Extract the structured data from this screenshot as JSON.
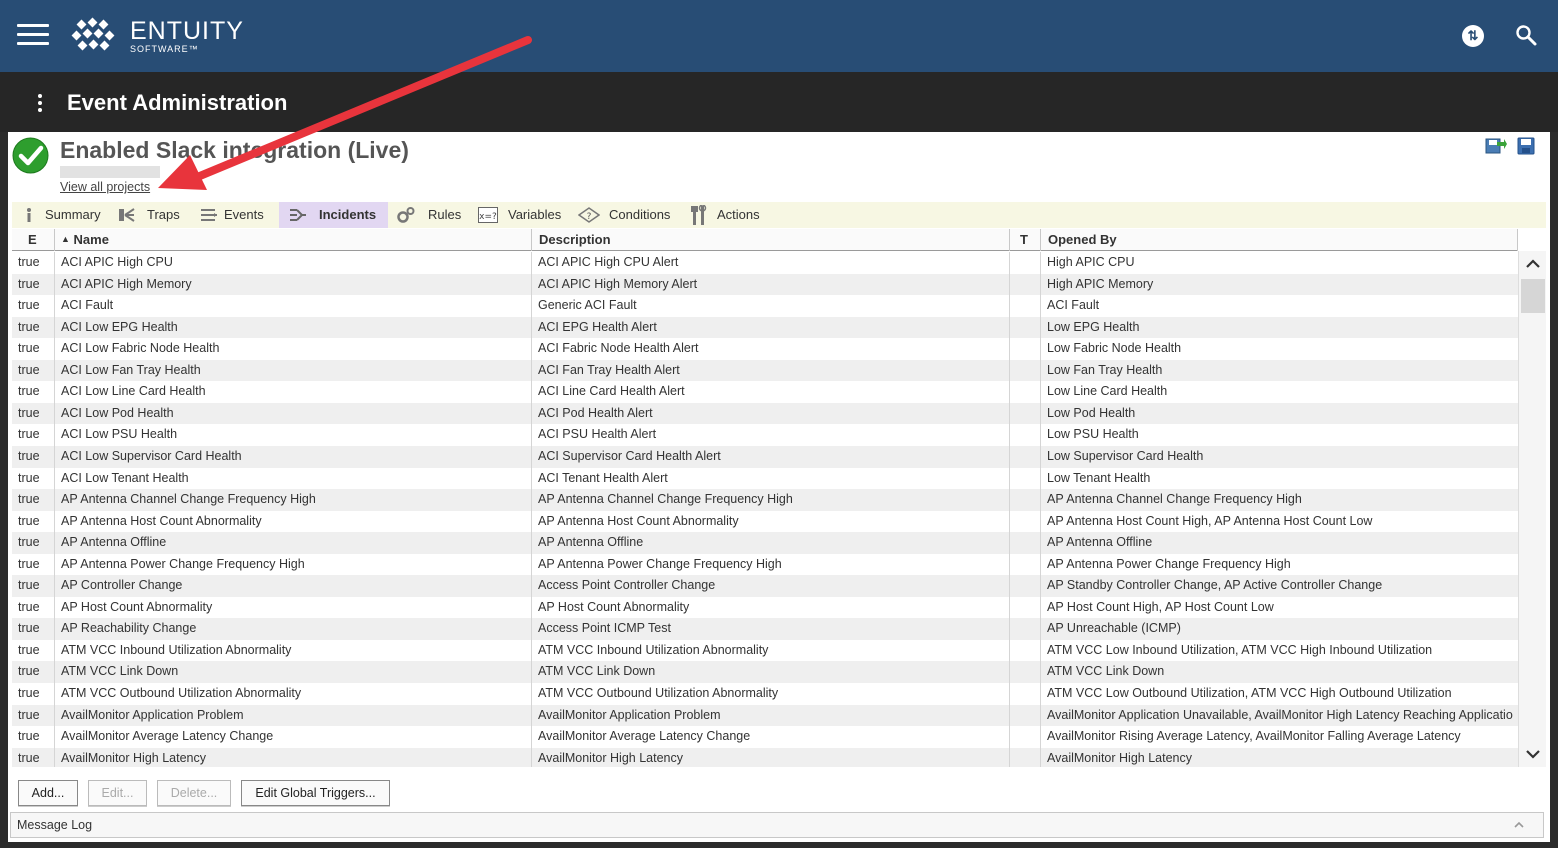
{
  "header": {
    "logo_name": "ENTUITY",
    "logo_sub": "SOFTWARE™",
    "brand_color": "#284d75",
    "icons": {
      "menu": "hamburger-icon",
      "sync": "sync-icon",
      "search": "search-icon"
    }
  },
  "page": {
    "title": "Event Administration",
    "menu_icon": "kebab-menu-icon"
  },
  "project": {
    "title": "Enabled Slack integration (Live)",
    "status_icon": "check-circle-icon",
    "status_color": "#2e9e2e",
    "view_all_link": "View all projects",
    "toolbar_icons": [
      "export-icon",
      "save-icon"
    ]
  },
  "tabs": [
    {
      "label": "Summary",
      "icon": "info-icon"
    },
    {
      "label": "Traps",
      "icon": "traps-icon"
    },
    {
      "label": "Events",
      "icon": "events-icon"
    },
    {
      "label": "Incidents",
      "icon": "incidents-icon",
      "active": true
    },
    {
      "label": "Rules",
      "icon": "gears-icon"
    },
    {
      "label": "Variables",
      "icon": "variables-icon"
    },
    {
      "label": "Conditions",
      "icon": "conditions-icon"
    },
    {
      "label": "Actions",
      "icon": "tools-icon"
    }
  ],
  "table": {
    "columns": [
      {
        "label": "E"
      },
      {
        "label": "Name",
        "sort": "ascending"
      },
      {
        "label": "Description"
      },
      {
        "label": "T"
      },
      {
        "label": "Opened By"
      }
    ],
    "rows": [
      [
        "true",
        "ACI APIC High CPU",
        "ACI APIC High CPU Alert",
        "",
        "High APIC CPU"
      ],
      [
        "true",
        "ACI APIC High Memory",
        "ACI APIC High Memory Alert",
        "",
        "High APIC Memory"
      ],
      [
        "true",
        "ACI Fault",
        "Generic ACI Fault",
        "",
        "ACI Fault"
      ],
      [
        "true",
        "ACI Low EPG Health",
        "ACI EPG Health Alert",
        "",
        "Low EPG Health"
      ],
      [
        "true",
        "ACI Low Fabric Node Health",
        "ACI Fabric Node Health Alert",
        "",
        "Low Fabric Node Health"
      ],
      [
        "true",
        "ACI Low Fan Tray Health",
        "ACI Fan Tray Health Alert",
        "",
        "Low Fan Tray Health"
      ],
      [
        "true",
        "ACI Low Line Card Health",
        "ACI Line Card Health Alert",
        "",
        "Low Line Card Health"
      ],
      [
        "true",
        "ACI Low Pod Health",
        "ACI Pod Health Alert",
        "",
        "Low Pod Health"
      ],
      [
        "true",
        "ACI Low PSU Health",
        "ACI PSU Health Alert",
        "",
        "Low PSU Health"
      ],
      [
        "true",
        "ACI Low Supervisor Card Health",
        "ACI Supervisor Card Health Alert",
        "",
        "Low Supervisor Card Health"
      ],
      [
        "true",
        "ACI Low Tenant Health",
        "ACI Tenant Health Alert",
        "",
        "Low Tenant Health"
      ],
      [
        "true",
        "AP Antenna Channel Change Frequency High",
        "AP Antenna Channel Change Frequency High",
        "",
        "AP Antenna Channel Change Frequency High"
      ],
      [
        "true",
        "AP Antenna Host Count Abnormality",
        "AP Antenna Host Count Abnormality",
        "",
        "AP Antenna Host Count High, AP Antenna Host Count Low"
      ],
      [
        "true",
        "AP Antenna Offline",
        "AP Antenna Offline",
        "",
        "AP Antenna Offline"
      ],
      [
        "true",
        "AP Antenna Power Change Frequency High",
        "AP Antenna Power Change Frequency High",
        "",
        "AP Antenna Power Change Frequency High"
      ],
      [
        "true",
        "AP Controller Change",
        "Access Point Controller Change",
        "",
        "AP Standby Controller Change, AP Active Controller Change"
      ],
      [
        "true",
        "AP Host Count Abnormality",
        "AP Host Count Abnormality",
        "",
        "AP Host Count High, AP Host Count Low"
      ],
      [
        "true",
        "AP Reachability Change",
        "Access Point ICMP Test",
        "",
        "AP Unreachable (ICMP)"
      ],
      [
        "true",
        "ATM VCC Inbound Utilization Abnormality",
        "ATM VCC Inbound Utilization Abnormality",
        "",
        "ATM VCC Low Inbound Utilization, ATM VCC High Inbound Utilization"
      ],
      [
        "true",
        "ATM VCC Link Down",
        "ATM VCC Link Down",
        "",
        "ATM VCC Link Down"
      ],
      [
        "true",
        "ATM VCC Outbound Utilization Abnormality",
        "ATM VCC Outbound Utilization Abnormality",
        "",
        "ATM VCC Low Outbound Utilization, ATM VCC High Outbound Utilization"
      ],
      [
        "true",
        "AvailMonitor Application Problem",
        "AvailMonitor Application Problem",
        "",
        "AvailMonitor Application Unavailable, AvailMonitor High Latency Reaching Applicatio"
      ],
      [
        "true",
        "AvailMonitor Average Latency Change",
        "AvailMonitor Average Latency Change",
        "",
        "AvailMonitor Rising Average Latency, AvailMonitor Falling Average Latency"
      ],
      [
        "true",
        "AvailMonitor High Latency",
        "AvailMonitor High Latency",
        "",
        "AvailMonitor High Latency"
      ]
    ]
  },
  "buttons": {
    "add": "Add...",
    "edit": "Edit...",
    "delete": "Delete...",
    "edit_global_triggers": "Edit Global Triggers..."
  },
  "message_log": {
    "label": "Message Log"
  },
  "annotation": {
    "arrow_color": "#e8343c"
  }
}
